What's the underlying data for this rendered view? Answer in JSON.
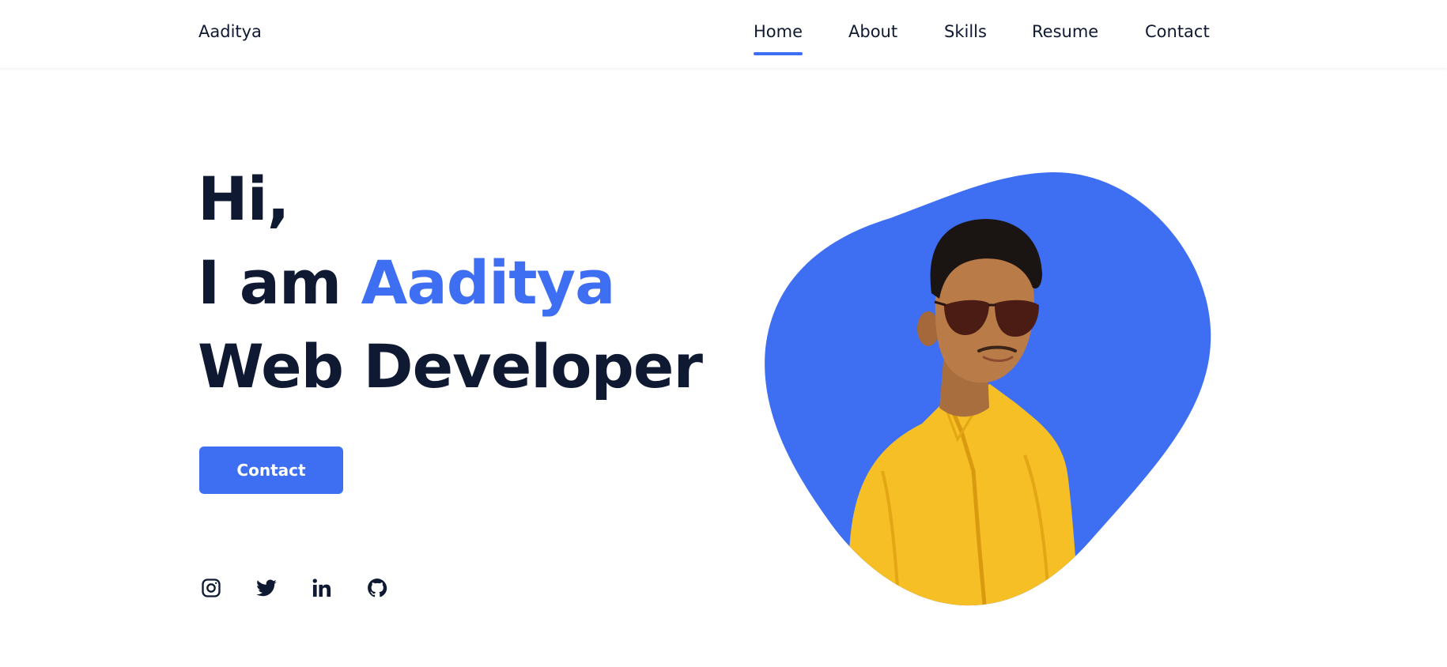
{
  "header": {
    "logo": "Aaditya",
    "nav": [
      {
        "label": "Home",
        "active": true
      },
      {
        "label": "About",
        "active": false
      },
      {
        "label": "Skills",
        "active": false
      },
      {
        "label": "Resume",
        "active": false
      },
      {
        "label": "Contact",
        "active": false
      }
    ]
  },
  "hero": {
    "greeting": "Hi,",
    "intro_prefix": "I am ",
    "name": "Aaditya",
    "role": "Web Developer",
    "cta_label": "Contact"
  },
  "social": [
    {
      "icon": "instagram-icon"
    },
    {
      "icon": "twitter-icon"
    },
    {
      "icon": "linkedin-icon"
    },
    {
      "icon": "github-icon"
    }
  ],
  "colors": {
    "accent": "#3e6ff2",
    "text": "#0f1a32",
    "background": "#ffffff",
    "shirt": "#f7bf26"
  }
}
